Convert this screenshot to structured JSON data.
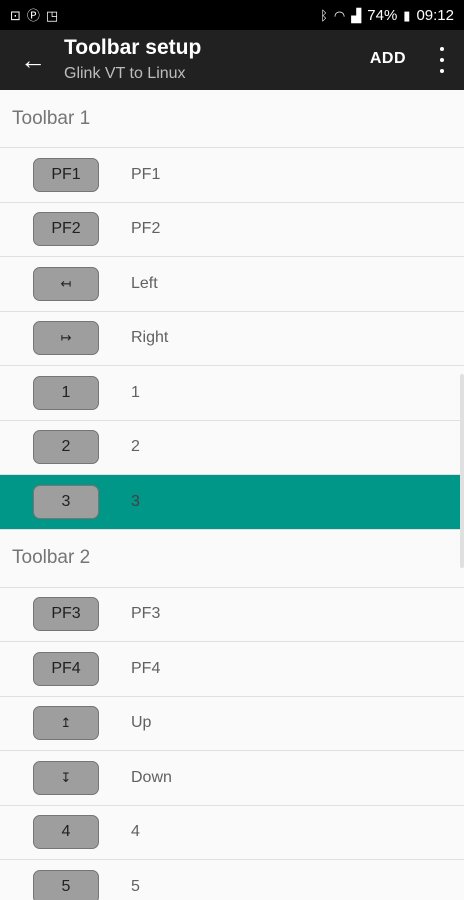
{
  "status_bar": {
    "left_icons": [
      "car-icon",
      "circle-p-icon",
      "cast-icon"
    ],
    "battery": "74%",
    "time": "09:12"
  },
  "appbar": {
    "title": "Toolbar setup",
    "subtitle": "Glink VT to Linux",
    "add_label": "ADD"
  },
  "toolbars": [
    {
      "header": "Toolbar 1",
      "rows": [
        {
          "key": "PF1",
          "label": "PF1"
        },
        {
          "key": "↤",
          "label": "Left"
        },
        {
          "key": "↦",
          "label": "Right"
        },
        {
          "key": "1",
          "label": "1"
        },
        {
          "key": "2",
          "label": "2"
        },
        {
          "key": "3",
          "label": "3"
        }
      ]
    },
    {
      "header": "Toolbar 2",
      "rows": [
        {
          "key": "PF3",
          "label": "PF3"
        },
        {
          "key": "PF4",
          "label": "PF4"
        },
        {
          "key": "↥",
          "label": "Up"
        },
        {
          "key": "↧",
          "label": "Down"
        },
        {
          "key": "4",
          "label": "4"
        },
        {
          "key": "5",
          "label": "5"
        }
      ]
    }
  ],
  "toolbar1_pf2": {
    "key": "PF2",
    "label": "PF2"
  },
  "accent_color": "#009688",
  "appbar_color": "#212121"
}
